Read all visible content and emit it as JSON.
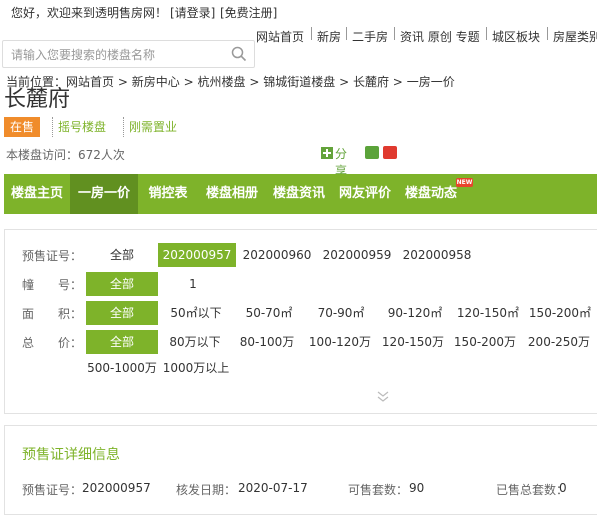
{
  "topbar": {
    "welcome": "您好，欢迎来到透明售房网！",
    "login": "[请登录]",
    "register": "[免费注册]",
    "nav": [
      "网站首页",
      "新房",
      "二手房",
      "资讯 原创 专题",
      "城区板块",
      "房屋类别"
    ]
  },
  "search": {
    "placeholder": "请输入您要搜索的楼盘名称"
  },
  "breadcrumb": {
    "prefix": "当前位置：",
    "items": [
      "网站首页",
      "新房中心",
      "杭州楼盘",
      "锦城街道楼盘",
      "长麓府",
      "一房一价"
    ],
    "separator": ">"
  },
  "project": {
    "title": "长麓府",
    "tags": [
      "在售",
      "摇号楼盘",
      "刚需置业"
    ],
    "visits": "本楼盘访问：672人次",
    "share_label": "分享"
  },
  "mainnav": {
    "tabs": [
      "楼盘主页",
      "一房一价",
      "销控表",
      "楼盘相册",
      "楼盘资讯",
      "网友评价",
      "楼盘动态"
    ],
    "active_index": 1,
    "badge": "NEW"
  },
  "filters": {
    "presale": {
      "label": "预售证号：",
      "options": [
        "全部",
        "202000957",
        "202000960",
        "202000959",
        "202000958"
      ],
      "selected": 1
    },
    "building": {
      "label": "幢　　号：",
      "options": [
        "全部",
        "1"
      ],
      "selected": 0
    },
    "area": {
      "label": "面　　积：",
      "options": [
        "全部",
        "50㎡以下",
        "50-70㎡",
        "70-90㎡",
        "90-120㎡",
        "120-150㎡",
        "150-200㎡"
      ],
      "selected": 0
    },
    "price": {
      "label": "总　　价：",
      "options": [
        "全部",
        "80万以下",
        "80-100万",
        "100-120万",
        "120-150万",
        "150-200万",
        "200-250万",
        "500-1000万",
        "1000万以上"
      ],
      "selected": 0
    }
  },
  "detail": {
    "title": "预售证详细信息",
    "presale_label": "预售证号：",
    "presale_value": "202000957",
    "date_label": "核发日期：",
    "date_value": "2020-07-17",
    "saleable_label": "可售套数：",
    "saleable_value": "90",
    "sold_label": "已售总套数：",
    "sold_value": "0"
  },
  "colors": {
    "accent_green": "#7eb32a",
    "active_green": "#619020",
    "orange": "#f08c2b"
  }
}
